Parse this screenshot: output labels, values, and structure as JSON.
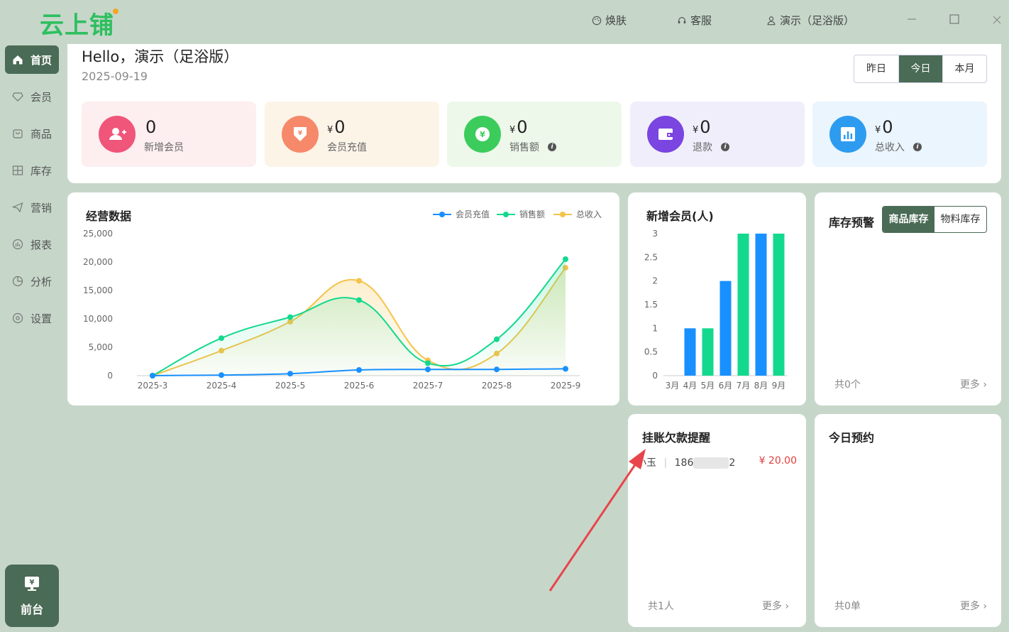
{
  "app": {
    "logo": "云上铺",
    "top_links": {
      "skin": "焕肤",
      "service": "客服",
      "user": "演示（足浴版）"
    }
  },
  "sidebar": {
    "items": [
      {
        "label": "首页",
        "icon": "home-icon"
      },
      {
        "label": "会员",
        "icon": "diamond-icon"
      },
      {
        "label": "商品",
        "icon": "bag-icon"
      },
      {
        "label": "库存",
        "icon": "inventory-icon"
      },
      {
        "label": "营销",
        "icon": "paper-plane-icon"
      },
      {
        "label": "报表",
        "icon": "report-icon"
      },
      {
        "label": "分析",
        "icon": "pie-icon"
      },
      {
        "label": "设置",
        "icon": "gear-icon"
      }
    ],
    "front_desk": "前台"
  },
  "greeting": {
    "hello": "Hello，演示（足浴版）",
    "date": "2025-09-19",
    "periods": [
      "昨日",
      "今日",
      "本月"
    ],
    "selected_period": "今日"
  },
  "stats": [
    {
      "currency": "",
      "value": "0",
      "label": "新增会员",
      "info": false,
      "bg": "#fdeef0",
      "icon_bg": "#f0557a",
      "icon": "add-user-icon"
    },
    {
      "currency": "¥",
      "value": "0",
      "label": "会员充值",
      "info": false,
      "bg": "#fdf4e8",
      "icon_bg": "#f6896a",
      "icon": "recharge-icon"
    },
    {
      "currency": "¥",
      "value": "0",
      "label": "销售额",
      "info": true,
      "bg": "#edf8ea",
      "icon_bg": "#3ccc5c",
      "icon": "yen-icon"
    },
    {
      "currency": "¥",
      "value": "0",
      "label": "退款",
      "info": true,
      "bg": "#f1eefb",
      "icon_bg": "#7a45e0",
      "icon": "wallet-icon"
    },
    {
      "currency": "¥",
      "value": "0",
      "label": "总收入",
      "info": true,
      "bg": "#eaf5fd",
      "icon_bg": "#2d9cf0",
      "icon": "chart-icon"
    }
  ],
  "business": {
    "title": "经营数据",
    "legend": [
      "会员充值",
      "销售额",
      "总收入"
    ]
  },
  "members_chart_title": "新增会员(人)",
  "stock": {
    "title": "库存预警",
    "tabs": [
      "商品库存",
      "物料库存"
    ],
    "total": "共0个",
    "more": "更多"
  },
  "debt": {
    "title": "挂账欠款提醒",
    "row": {
      "name": "小玉",
      "phone_start": "186",
      "phone_end": "2",
      "amount": "¥ 20.00"
    },
    "total": "共1人",
    "more": "更多"
  },
  "appointment": {
    "title": "今日预约",
    "total": "共0单",
    "more": "更多"
  },
  "colors": {
    "brand": "#4a6b55",
    "blue": "#1890ff",
    "green": "#13d98e",
    "yellow": "#f5c34b",
    "red_arrow": "#e8454a"
  },
  "chart_data": [
    {
      "type": "line",
      "title": "经营数据",
      "categories": [
        "2025-3",
        "2025-4",
        "2025-5",
        "2025-6",
        "2025-7",
        "2025-8",
        "2025-9"
      ],
      "ylim": [
        0,
        25000
      ],
      "yticks": [
        "0",
        "5,000",
        "10,000",
        "15,000",
        "20,000",
        "25,000"
      ],
      "series": [
        {
          "name": "会员充值",
          "color": "#1890ff",
          "values": [
            0,
            100,
            350,
            1000,
            1100,
            1100,
            1200
          ]
        },
        {
          "name": "销售额",
          "color": "#13d98e",
          "values": [
            0,
            6600,
            10300,
            13300,
            2200,
            6400,
            20500
          ]
        },
        {
          "name": "总收入",
          "color": "#f5c34b",
          "values": [
            0,
            4400,
            9500,
            16700,
            2700,
            3900,
            19000
          ]
        }
      ]
    },
    {
      "type": "bar",
      "title": "新增会员(人)",
      "categories": [
        "3月",
        "4月",
        "5月",
        "6月",
        "7月",
        "8月",
        "9月"
      ],
      "values": [
        0,
        1,
        1,
        2,
        3,
        3,
        3
      ],
      "colors": [
        "#13d98e",
        "#1890ff",
        "#13d98e",
        "#1890ff",
        "#13d98e",
        "#1890ff",
        "#13d98e"
      ],
      "ylim": [
        0,
        3
      ],
      "yticks": [
        "0",
        "0.5",
        "1",
        "1.5",
        "2",
        "2.5",
        "3"
      ]
    }
  ]
}
